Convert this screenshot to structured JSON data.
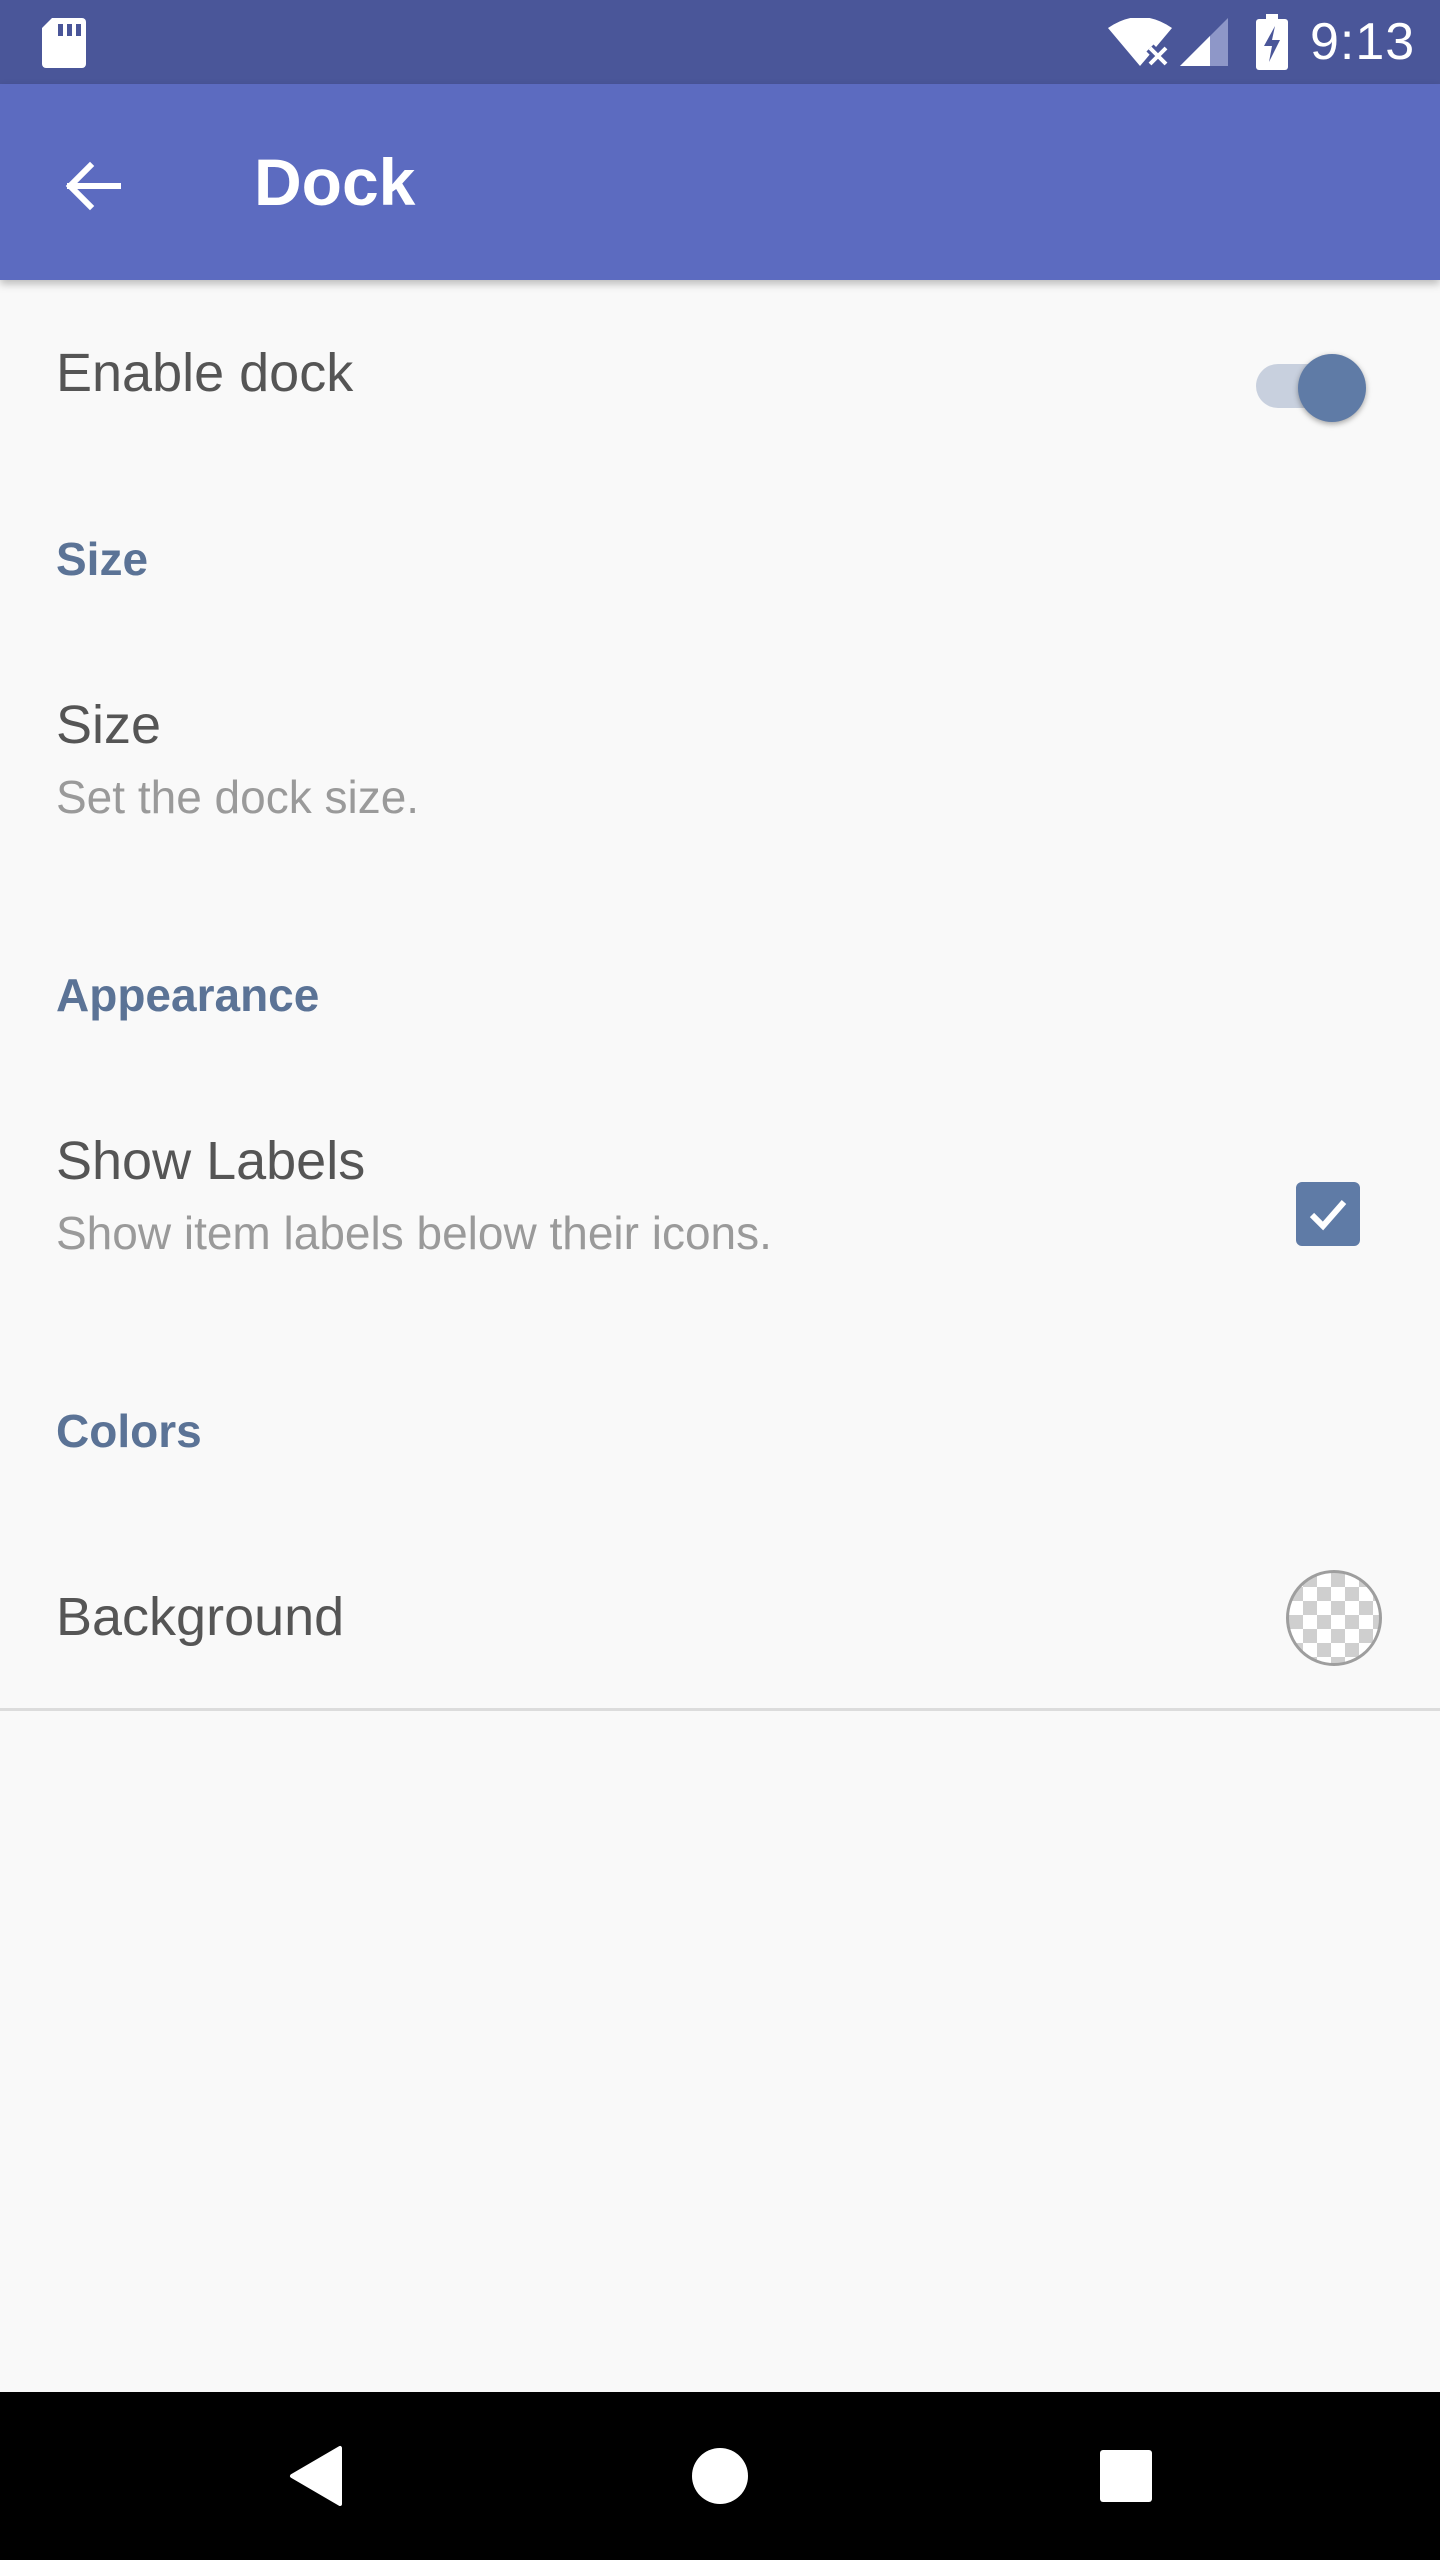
{
  "status_bar": {
    "time": "9:13",
    "icons": [
      "sd-card-icon",
      "wifi-icon",
      "cell-signal-icon",
      "battery-charging-icon"
    ]
  },
  "app_bar": {
    "title": "Dock",
    "back_icon": "arrow-back-icon"
  },
  "preferences": {
    "enable_dock": {
      "title": "Enable dock",
      "enabled": true
    },
    "sections": {
      "size": "Size",
      "appearance": "Appearance",
      "colors": "Colors"
    },
    "size": {
      "title": "Size",
      "summary": "Set the dock size."
    },
    "show_labels": {
      "title": "Show Labels",
      "summary": "Show item labels below their icons.",
      "checked": true
    },
    "background": {
      "title": "Background",
      "swatch": "transparent-checker"
    }
  },
  "nav_bar": {
    "icons": [
      "back-triangle-icon",
      "home-circle-icon",
      "recents-square-icon"
    ]
  },
  "colors": {
    "status_bar": "#4a5699",
    "app_bar": "#5c6bc0",
    "accent": "#5f7ba6",
    "section_header": "#5b7396",
    "background": "#f9f9f9"
  }
}
